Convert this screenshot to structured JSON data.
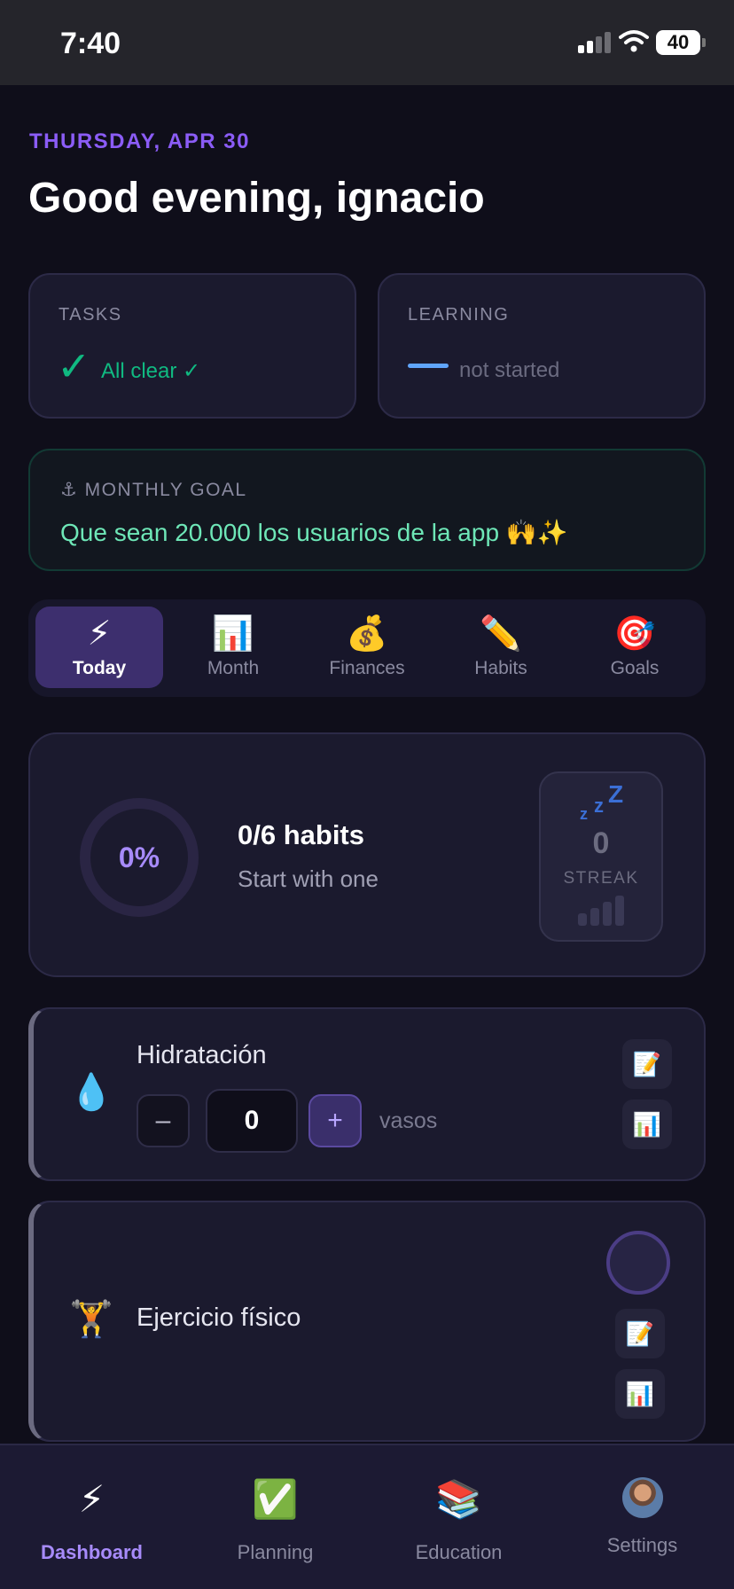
{
  "status_bar": {
    "time": "7:40",
    "battery": "40"
  },
  "header": {
    "date": "THURSDAY, APR 30",
    "greeting": "Good evening, ignacio"
  },
  "tasks_card": {
    "label": "TASKS",
    "icon": "✓",
    "status": "All clear ✓"
  },
  "learning_card": {
    "label": "LEARNING",
    "status": "not started"
  },
  "monthly_goal": {
    "label": "⚓ MONTHLY GOAL",
    "text": "Que sean 20.000 los usuarios de la app 🙌✨"
  },
  "tabs": [
    {
      "icon": "⚡",
      "label": "Today",
      "active": true
    },
    {
      "icon": "📊",
      "label": "Month",
      "active": false
    },
    {
      "icon": "💰",
      "label": "Finances",
      "active": false
    },
    {
      "icon": "✏️",
      "label": "Habits",
      "active": false
    },
    {
      "icon": "🎯",
      "label": "Goals",
      "active": false
    }
  ],
  "summary": {
    "percent": "0%",
    "habits": "0/6 habits",
    "subtitle": "Start with one",
    "streak_value": "0",
    "streak_label": "STREAK"
  },
  "habits": [
    {
      "icon": "💧",
      "name": "Hidratación",
      "minus": "–",
      "count": "0",
      "plus": "+",
      "unit": "vasos",
      "note_icon": "📝",
      "stats_icon": "📊"
    },
    {
      "icon": "🏋️",
      "name": "Ejercicio físico",
      "note_icon": "📝",
      "stats_icon": "📊"
    }
  ],
  "bottom_nav": [
    {
      "icon": "⚡",
      "label": "Dashboard",
      "active": true
    },
    {
      "icon": "✅",
      "label": "Planning",
      "active": false
    },
    {
      "icon": "📚",
      "label": "Education",
      "active": false
    },
    {
      "icon": "avatar",
      "label": "Settings",
      "active": false
    }
  ],
  "colors": {
    "accent": "#8b5cf6",
    "success": "#10b981",
    "info": "#60a5fa",
    "background": "#0f0e1a",
    "card": "#1b1a2e"
  }
}
